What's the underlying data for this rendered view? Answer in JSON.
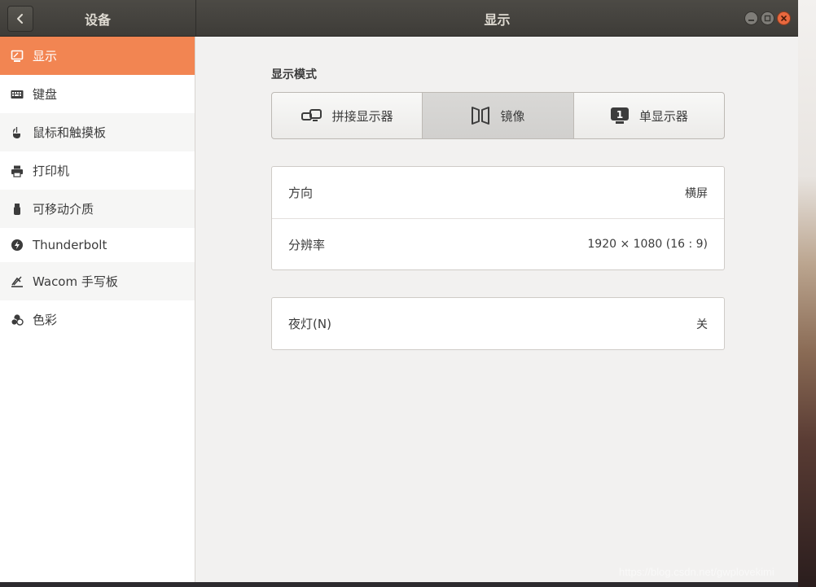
{
  "header": {
    "left_title": "设备",
    "main_title": "显示"
  },
  "sidebar": {
    "items": [
      {
        "label": "显示",
        "icon": "display-icon",
        "active": true
      },
      {
        "label": "键盘",
        "icon": "keyboard-icon"
      },
      {
        "label": "鼠标和触摸板",
        "icon": "mouse-icon"
      },
      {
        "label": "打印机",
        "icon": "printer-icon"
      },
      {
        "label": "可移动介质",
        "icon": "usb-drive-icon"
      },
      {
        "label": "Thunderbolt",
        "icon": "thunderbolt-icon"
      },
      {
        "label": "Wacom 手写板",
        "icon": "tablet-icon"
      },
      {
        "label": "色彩",
        "icon": "color-icon"
      }
    ]
  },
  "display_mode": {
    "title": "显示模式",
    "options": [
      {
        "label": "拼接显示器",
        "icon": "join-displays-icon"
      },
      {
        "label": "镜像",
        "icon": "mirror-icon",
        "selected": true
      },
      {
        "label": "单显示器",
        "icon": "single-display-icon",
        "badge": "1"
      }
    ]
  },
  "settings": {
    "orientation": {
      "label": "方向",
      "value": "横屏"
    },
    "resolution": {
      "label": "分辨率",
      "value": "1920 × 1080 (16 : 9)"
    }
  },
  "night_light": {
    "label": "夜灯(N)",
    "value": "关"
  },
  "watermark": "https://blog.csdn.net/gwplovekimi",
  "colors": {
    "accent": "#f28552",
    "headerbar": "#3e3c38",
    "close": "#e9683e"
  }
}
